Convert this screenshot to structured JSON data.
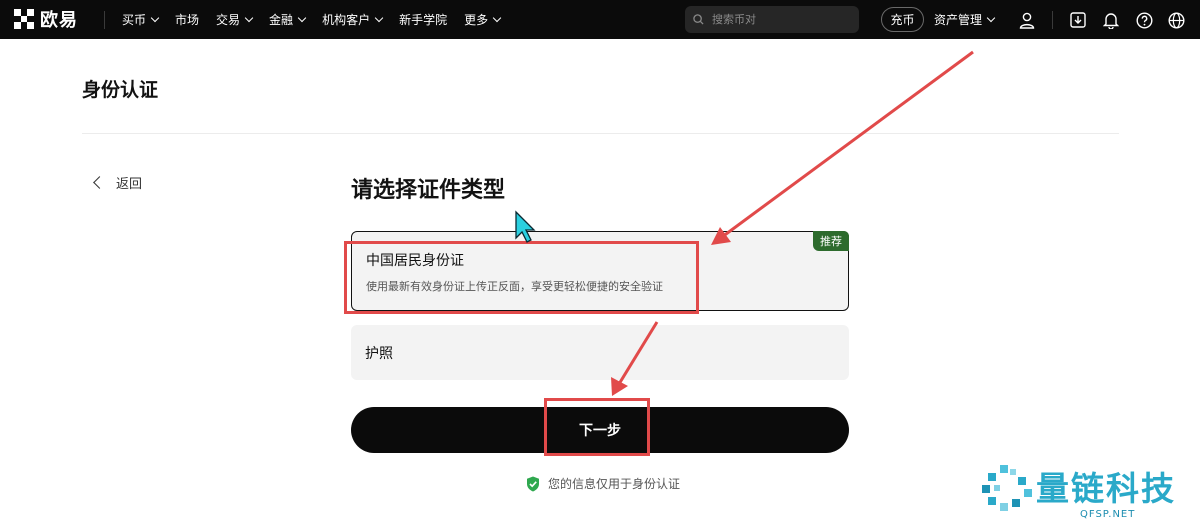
{
  "nav": {
    "logo_text": "欧易",
    "items": [
      {
        "label": "买币",
        "dropdown": true
      },
      {
        "label": "市场",
        "dropdown": false
      },
      {
        "label": "交易",
        "dropdown": true
      },
      {
        "label": "金融",
        "dropdown": true
      },
      {
        "label": "机构客户",
        "dropdown": true
      },
      {
        "label": "新手学院",
        "dropdown": false
      },
      {
        "label": "更多",
        "dropdown": true
      }
    ],
    "search_placeholder": "搜索币对",
    "deposit_label": "充币",
    "assets_label": "资产管理",
    "icons": [
      "user-icon",
      "download-icon",
      "bell-icon",
      "help-icon",
      "globe-icon"
    ]
  },
  "page": {
    "title": "身份认证",
    "back_label": "返回",
    "heading": "请选择证件类型",
    "options": [
      {
        "title": "中国居民身份证",
        "description": "使用最新有效身份证上传正反面，享受更轻松便捷的安全验证",
        "badge": "推荐",
        "selected": true
      },
      {
        "title": "护照",
        "selected": false
      }
    ],
    "next_label": "下一步",
    "privacy_note": "您的信息仅用于身份认证"
  },
  "watermark": {
    "text": "量链科技",
    "sub": "QFSP.NET"
  },
  "colors": {
    "nav_bg": "#0b0b0b",
    "badge_green": "#2d6b2d",
    "annotation_red": "#e14a4a",
    "shield_green": "#2fa84f",
    "watermark_blue": "#2aa9c9"
  }
}
